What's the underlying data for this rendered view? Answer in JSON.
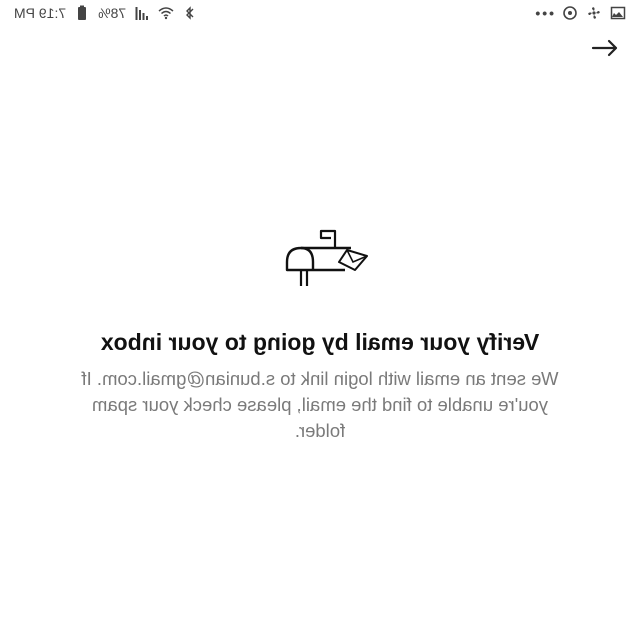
{
  "status_bar": {
    "time": "7:19 PM",
    "battery": "78%"
  },
  "message": {
    "title": "Verify your email by going to your inbox",
    "body": "We sent an email with login link to s.bunian@gmail.com. If you're unable to find the email, please check your spam folder."
  },
  "icons": {
    "back": "back-arrow-icon",
    "illustration": "mailbox-icon"
  }
}
